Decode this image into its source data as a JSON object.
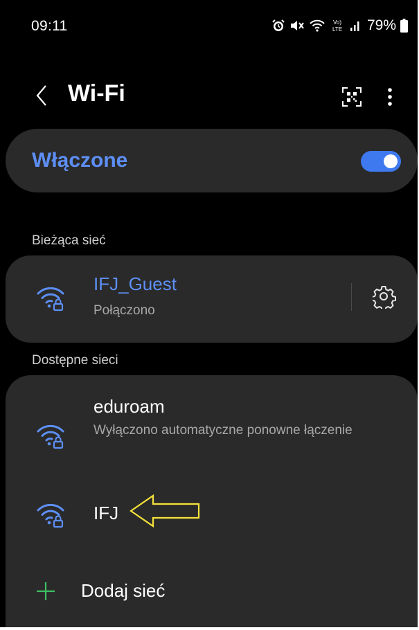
{
  "status_bar": {
    "time": "09:11",
    "battery": "79%",
    "icons": [
      "alarm-icon",
      "mute-icon",
      "wifi-status-icon",
      "volte-icon",
      "signal-icon",
      "battery-icon"
    ]
  },
  "header": {
    "title": "Wi-Fi",
    "icons": [
      "back-icon",
      "qr-scan-icon",
      "more-options-icon"
    ]
  },
  "toggle": {
    "label": "Włączone",
    "state": true,
    "accent_color": "#3e79f0"
  },
  "current_network": {
    "section_label": "Bieżąca sieć",
    "name": "IFJ_Guest",
    "status": "Połączono"
  },
  "available_networks": {
    "section_label": "Dostępne sieci",
    "items": [
      {
        "name": "eduroam",
        "status": "Wyłączono automatyczne ponowne łączenie"
      },
      {
        "name": "IFJ",
        "status": ""
      }
    ],
    "add_label": "Dodaj sieć"
  },
  "colors": {
    "background": "#000000",
    "card": "#2a2a2a",
    "accent_blue": "#5d8ff5",
    "add_green": "#3fbf63",
    "annotation_yellow": "#f5e23a"
  }
}
